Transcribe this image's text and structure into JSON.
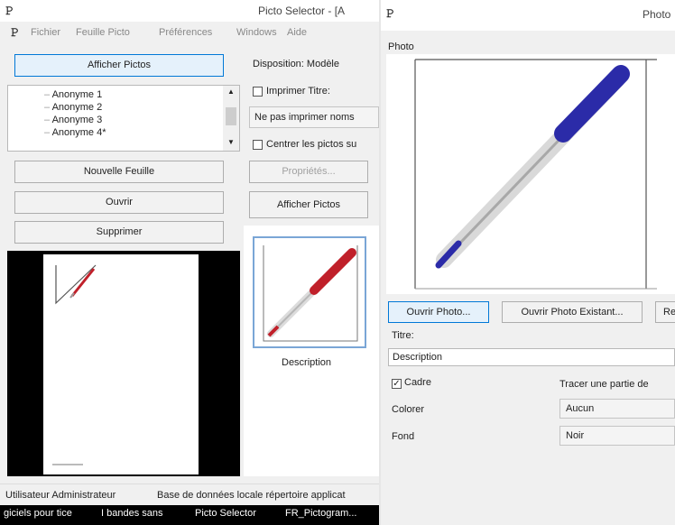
{
  "left_window": {
    "title": "Picto Selector - [A",
    "menu": [
      "Fichier",
      "Feuille Picto",
      "Préférences",
      "Windows",
      "Aide"
    ],
    "afficher_pictos_top": "Afficher Pictos",
    "list_items": [
      "Anonyme 1",
      "Anonyme 2",
      "Anonyme 3",
      "Anonyme 4*"
    ],
    "nouvelle_feuille": "Nouvelle Feuille",
    "ouvrir": "Ouvrir",
    "supprimer": "Supprimer",
    "disposition_label": "Disposition: Modèle",
    "imprimer_titre": "Imprimer Titre:",
    "ne_pas_imprimer": "Ne pas imprimer noms",
    "centrer_pictos": "Centrer les pictos su",
    "proprietes": "Propriétés...",
    "afficher_pictos_right": "Afficher Pictos",
    "picto_caption": "Description",
    "status_user": "Utilisateur Administrateur",
    "status_db": "Base de données locale répertoire applicat",
    "taskbar_items": [
      "giciels pour tice",
      "I bandes sans",
      "Picto Selector",
      "FR_Pictogram..."
    ]
  },
  "right_window": {
    "title": "Photo",
    "group_label": "Photo",
    "ouvrir_photo": "Ouvrir Photo...",
    "ouvrir_photo_existant": "Ouvrir Photo Existant...",
    "re_button": "Re",
    "titre_label": "Titre:",
    "titre_value": "Description",
    "cadre_label": "Cadre",
    "tracer_label": "Tracer une partie de",
    "colorer_label": "Colorer",
    "colorer_value": "Aucun",
    "fond_label": "Fond",
    "fond_value": "Noir"
  },
  "colors": {
    "accent": "#0078d7",
    "pen_red": "#c0202a",
    "pen_blue": "#2b2ba8",
    "dark_bg": "#000000"
  }
}
